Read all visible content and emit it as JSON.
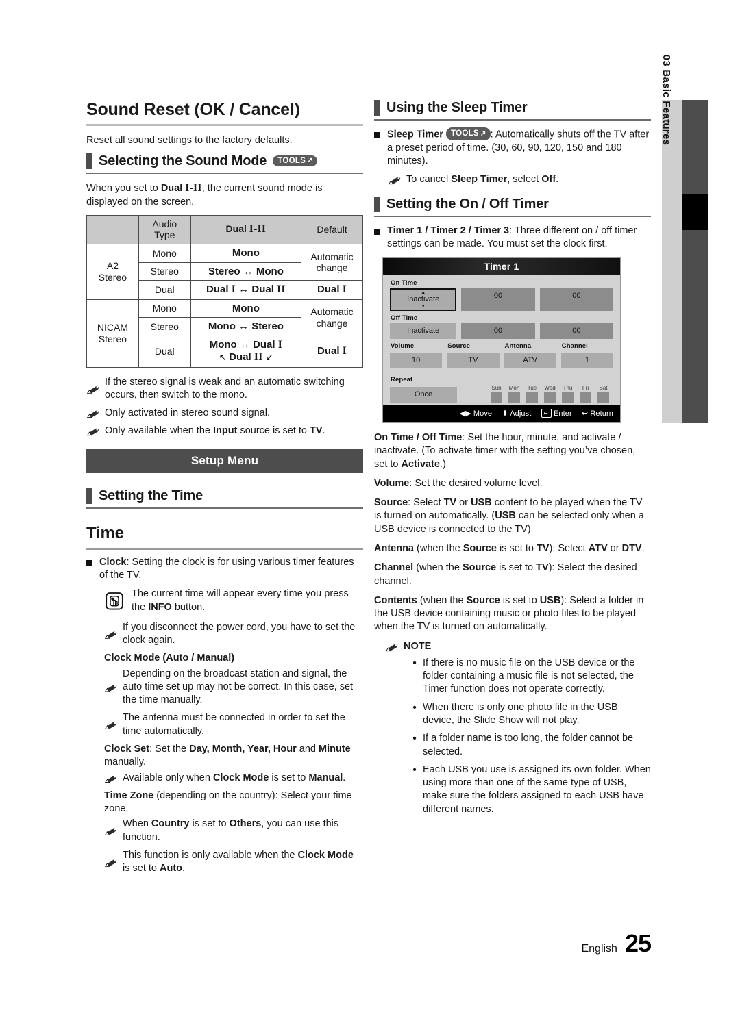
{
  "left": {
    "sound_reset": {
      "title": "Sound Reset (OK / Cancel)",
      "body": "Reset all sound settings to the factory defaults."
    },
    "sound_mode": {
      "heading": "Selecting the Sound Mode",
      "tools_label": "TOOLS",
      "intro_a": "When you set to ",
      "intro_dual": "Dual I-II",
      "intro_b": ", the current sound mode is displayed on the screen."
    },
    "table": {
      "headers": [
        "",
        "Audio Type",
        "Dual I-II",
        "Default"
      ],
      "header_audio_line1": "Audio",
      "header_audio_line2": "Type",
      "header_dual_word": "Dual",
      "header_dual_rom": "I-II",
      "header_default": "Default",
      "groups": [
        {
          "name_line1": "A2",
          "name_line2": "Stereo",
          "rows": [
            {
              "type": "Mono",
              "dual": "Mono",
              "default": "Automatic change",
              "default_rowspan": 2
            },
            {
              "type": "Stereo",
              "dual": "Stereo ↔ Mono"
            },
            {
              "type": "Dual",
              "dual": "Dual I ↔ Dual II",
              "default": "Dual I"
            }
          ]
        },
        {
          "name_line1": "NICAM",
          "name_line2": "Stereo",
          "rows": [
            {
              "type": "Mono",
              "dual": "Mono",
              "default": "Automatic change",
              "default_rowspan": 2
            },
            {
              "type": "Stereo",
              "dual": "Mono ↔ Stereo"
            },
            {
              "type": "Dual",
              "dual_line1": "Mono ↔ Dual I",
              "dual_line2": "↖ Dual II ↙",
              "default": "Dual I"
            }
          ]
        }
      ]
    },
    "notes_after_table": [
      "If the stereo signal is weak and an automatic switching occurs, then switch to the mono.",
      "Only activated in stereo sound signal.",
      "Only available when the Input source is set to TV."
    ],
    "setup_menu_banner": "Setup Menu",
    "setting_the_time_heading": "Setting the Time",
    "time_heading": "Time",
    "clock_bullet_bold": "Clock",
    "clock_bullet_rest": ": Setting the clock is for using various timer features of the TV.",
    "info_note": "The current time will appear every time you press the INFO button.",
    "info_note_bold": "INFO",
    "power_cord_note": "If you disconnect the power cord, you have to set the clock again.",
    "clock_mode_heading": "Clock Mode (Auto / Manual)",
    "clock_mode_note1": "Depending on the broadcast station and signal, the auto time set up may not be correct. In this case, set the time manually.",
    "clock_mode_note2": "The antenna must be connected in order to set the time automatically.",
    "clock_set_bold": "Clock Set",
    "clock_set_rest": ": Set the Day, Month, Year, Hour and Minute manually.",
    "clock_set_note": "Available only when Clock Mode is set to Manual.",
    "time_zone_bold": "Time Zone",
    "time_zone_rest": " (depending on the country): Select your time zone.",
    "time_zone_note1": "When Country is set to Others, you can use this function.",
    "time_zone_note2": "This function is only available when the Clock Mode is set to Auto."
  },
  "right": {
    "sleep_timer_heading": "Using the Sleep Timer",
    "sleep_timer_bold": "Sleep Timer",
    "sleep_timer_tools": "TOOLS",
    "sleep_timer_rest": ": Automatically shuts off the TV after a preset period of time. (30, 60, 90, 120, 150 and 180 minutes).",
    "sleep_timer_note": "To cancel Sleep Timer, select Off.",
    "onoff_timer_heading": "Setting the On / Off Timer",
    "timer_bullet_bold": "Timer 1 / Timer 2 / Timer 3",
    "timer_bullet_rest": ": Three different on / off timer settings can be made. You must set the clock first.",
    "paras": [
      {
        "bold": "On Time / Off Time",
        "rest": ": Set the hour, minute, and activate / inactivate. (To activate timer with the setting you've chosen, set to Activate.)"
      },
      {
        "bold": "Volume",
        "rest": ": Set the desired volume level."
      },
      {
        "bold": "Source",
        "rest": ": Select TV or USB content to be played when the TV is turned on automatically. (USB can be selected only when a USB device is connected to the TV)"
      },
      {
        "bold": "Antenna",
        "rest": " (when the Source is set to TV): Select ATV or DTV."
      },
      {
        "bold": "Channel",
        "rest": " (when the Source is set to TV): Select the desired channel."
      },
      {
        "bold": "Contents",
        "rest": " (when the Source is set to USB): Select a folder in the USB device containing music or photo files to be played when the TV is turned on automatically."
      }
    ],
    "note_label": "NOTE",
    "note_bullets": [
      "If there is no music file on the USB device or the folder containing a music file is not selected, the Timer function does not operate correctly.",
      "When there is only one photo file in the USB device, the Slide Show will not play.",
      "If a folder name is too long, the folder cannot be selected.",
      "Each USB you use is assigned its own folder. When using more than one of the same type of USB, make sure the folders assigned to each USB have different names."
    ]
  },
  "osd": {
    "title": "Timer 1",
    "on_time_label": "On Time",
    "off_time_label": "Off Time",
    "on_time": {
      "state": "Inactivate",
      "hour": "00",
      "minute": "00"
    },
    "off_time": {
      "state": "Inactivate",
      "hour": "00",
      "minute": "00"
    },
    "fields": [
      {
        "label": "Volume",
        "value": "10"
      },
      {
        "label": "Source",
        "value": "TV"
      },
      {
        "label": "Antenna",
        "value": "ATV"
      },
      {
        "label": "Channel",
        "value": "1"
      }
    ],
    "repeat_label": "Repeat",
    "repeat_value": "Once",
    "days": [
      "Sun",
      "Mon",
      "Tue",
      "Wed",
      "Thu",
      "Fri",
      "Sat"
    ],
    "footer": [
      {
        "icon": "◀▶",
        "label": "Move"
      },
      {
        "icon": "⬍",
        "label": "Adjust"
      },
      {
        "icon": "↵",
        "label": "Enter"
      },
      {
        "icon": "↩",
        "label": "Return"
      }
    ]
  },
  "side_tab": {
    "number": "03",
    "label": "Basic Features",
    "combined": "03   Basic Features"
  },
  "footer": {
    "language": "English",
    "page_number": "25"
  },
  "colors": {
    "section_bar": "#4d4d4d",
    "banner_bg": "#4d4d4d",
    "table_header_bg": "#c9c9c9",
    "osd_bg": "#d2d2d2",
    "osd_field": "#ababab",
    "osd_field_dark": "#8c8c8c",
    "tab_light": "#cfcfcf",
    "tab_dark": "#4d4d4d"
  }
}
